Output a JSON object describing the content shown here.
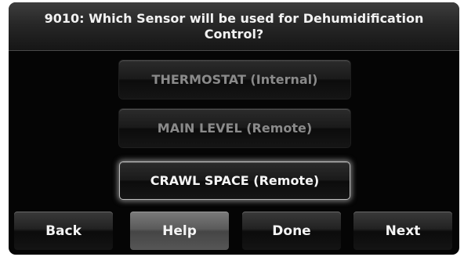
{
  "header": {
    "title": "9010: Which Sensor will be used for Dehumidification Control?"
  },
  "options": [
    {
      "label": "THERMOSTAT (Internal)",
      "state": "inactive"
    },
    {
      "label": "MAIN LEVEL (Remote)",
      "state": "inactive"
    },
    {
      "label": "CRAWL SPACE (Remote)",
      "state": "selected"
    }
  ],
  "nav": {
    "back_label": "Back",
    "help_label": "Help",
    "done_label": "Done",
    "next_label": "Next"
  },
  "colors": {
    "screen_bg": "#050505",
    "selected_text": "#f6f6f6",
    "inactive_text": "#8a8a8a",
    "help_button": "#5b5b5b"
  }
}
